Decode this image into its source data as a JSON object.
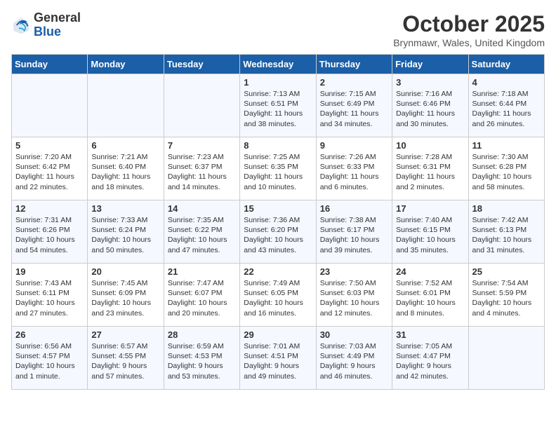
{
  "header": {
    "logo_general": "General",
    "logo_blue": "Blue",
    "month": "October 2025",
    "location": "Brynmawr, Wales, United Kingdom"
  },
  "weekdays": [
    "Sunday",
    "Monday",
    "Tuesday",
    "Wednesday",
    "Thursday",
    "Friday",
    "Saturday"
  ],
  "weeks": [
    [
      {
        "day": "",
        "text": ""
      },
      {
        "day": "",
        "text": ""
      },
      {
        "day": "",
        "text": ""
      },
      {
        "day": "1",
        "text": "Sunrise: 7:13 AM\nSunset: 6:51 PM\nDaylight: 11 hours\nand 38 minutes."
      },
      {
        "day": "2",
        "text": "Sunrise: 7:15 AM\nSunset: 6:49 PM\nDaylight: 11 hours\nand 34 minutes."
      },
      {
        "day": "3",
        "text": "Sunrise: 7:16 AM\nSunset: 6:46 PM\nDaylight: 11 hours\nand 30 minutes."
      },
      {
        "day": "4",
        "text": "Sunrise: 7:18 AM\nSunset: 6:44 PM\nDaylight: 11 hours\nand 26 minutes."
      }
    ],
    [
      {
        "day": "5",
        "text": "Sunrise: 7:20 AM\nSunset: 6:42 PM\nDaylight: 11 hours\nand 22 minutes."
      },
      {
        "day": "6",
        "text": "Sunrise: 7:21 AM\nSunset: 6:40 PM\nDaylight: 11 hours\nand 18 minutes."
      },
      {
        "day": "7",
        "text": "Sunrise: 7:23 AM\nSunset: 6:37 PM\nDaylight: 11 hours\nand 14 minutes."
      },
      {
        "day": "8",
        "text": "Sunrise: 7:25 AM\nSunset: 6:35 PM\nDaylight: 11 hours\nand 10 minutes."
      },
      {
        "day": "9",
        "text": "Sunrise: 7:26 AM\nSunset: 6:33 PM\nDaylight: 11 hours\nand 6 minutes."
      },
      {
        "day": "10",
        "text": "Sunrise: 7:28 AM\nSunset: 6:31 PM\nDaylight: 11 hours\nand 2 minutes."
      },
      {
        "day": "11",
        "text": "Sunrise: 7:30 AM\nSunset: 6:28 PM\nDaylight: 10 hours\nand 58 minutes."
      }
    ],
    [
      {
        "day": "12",
        "text": "Sunrise: 7:31 AM\nSunset: 6:26 PM\nDaylight: 10 hours\nand 54 minutes."
      },
      {
        "day": "13",
        "text": "Sunrise: 7:33 AM\nSunset: 6:24 PM\nDaylight: 10 hours\nand 50 minutes."
      },
      {
        "day": "14",
        "text": "Sunrise: 7:35 AM\nSunset: 6:22 PM\nDaylight: 10 hours\nand 47 minutes."
      },
      {
        "day": "15",
        "text": "Sunrise: 7:36 AM\nSunset: 6:20 PM\nDaylight: 10 hours\nand 43 minutes."
      },
      {
        "day": "16",
        "text": "Sunrise: 7:38 AM\nSunset: 6:17 PM\nDaylight: 10 hours\nand 39 minutes."
      },
      {
        "day": "17",
        "text": "Sunrise: 7:40 AM\nSunset: 6:15 PM\nDaylight: 10 hours\nand 35 minutes."
      },
      {
        "day": "18",
        "text": "Sunrise: 7:42 AM\nSunset: 6:13 PM\nDaylight: 10 hours\nand 31 minutes."
      }
    ],
    [
      {
        "day": "19",
        "text": "Sunrise: 7:43 AM\nSunset: 6:11 PM\nDaylight: 10 hours\nand 27 minutes."
      },
      {
        "day": "20",
        "text": "Sunrise: 7:45 AM\nSunset: 6:09 PM\nDaylight: 10 hours\nand 23 minutes."
      },
      {
        "day": "21",
        "text": "Sunrise: 7:47 AM\nSunset: 6:07 PM\nDaylight: 10 hours\nand 20 minutes."
      },
      {
        "day": "22",
        "text": "Sunrise: 7:49 AM\nSunset: 6:05 PM\nDaylight: 10 hours\nand 16 minutes."
      },
      {
        "day": "23",
        "text": "Sunrise: 7:50 AM\nSunset: 6:03 PM\nDaylight: 10 hours\nand 12 minutes."
      },
      {
        "day": "24",
        "text": "Sunrise: 7:52 AM\nSunset: 6:01 PM\nDaylight: 10 hours\nand 8 minutes."
      },
      {
        "day": "25",
        "text": "Sunrise: 7:54 AM\nSunset: 5:59 PM\nDaylight: 10 hours\nand 4 minutes."
      }
    ],
    [
      {
        "day": "26",
        "text": "Sunrise: 6:56 AM\nSunset: 4:57 PM\nDaylight: 10 hours\nand 1 minute."
      },
      {
        "day": "27",
        "text": "Sunrise: 6:57 AM\nSunset: 4:55 PM\nDaylight: 9 hours\nand 57 minutes."
      },
      {
        "day": "28",
        "text": "Sunrise: 6:59 AM\nSunset: 4:53 PM\nDaylight: 9 hours\nand 53 minutes."
      },
      {
        "day": "29",
        "text": "Sunrise: 7:01 AM\nSunset: 4:51 PM\nDaylight: 9 hours\nand 49 minutes."
      },
      {
        "day": "30",
        "text": "Sunrise: 7:03 AM\nSunset: 4:49 PM\nDaylight: 9 hours\nand 46 minutes."
      },
      {
        "day": "31",
        "text": "Sunrise: 7:05 AM\nSunset: 4:47 PM\nDaylight: 9 hours\nand 42 minutes."
      },
      {
        "day": "",
        "text": ""
      }
    ]
  ]
}
